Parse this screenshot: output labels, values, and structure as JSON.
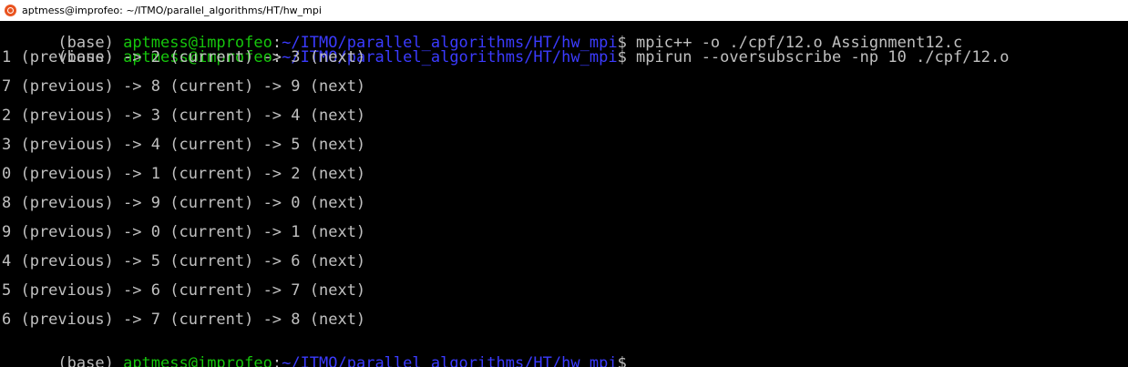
{
  "window": {
    "title": "aptmess@improfeo: ~/ITMO/parallel_algorithms/HT/hw_mpi",
    "icon": "ubuntu-icon"
  },
  "colors": {
    "user_host": "#16c60c",
    "path": "#3b3bff",
    "text": "#c0c0c0",
    "background": "#000000"
  },
  "prompt": {
    "env": "(base) ",
    "user_host": "aptmess@improfeo",
    "sep": ":",
    "path": "~/ITMO/parallel_algorithms/HT/hw_mpi",
    "symbol": "$ "
  },
  "commands": [
    "mpic++ -o ./cpf/12.o Assignment12.c",
    "mpirun --oversubscribe -np 10 ./cpf/12.o"
  ],
  "output": [
    "1 (previous) -> 2 (current) -> 3 (next)",
    "7 (previous) -> 8 (current) -> 9 (next)",
    "2 (previous) -> 3 (current) -> 4 (next)",
    "3 (previous) -> 4 (current) -> 5 (next)",
    "0 (previous) -> 1 (current) -> 2 (next)",
    "8 (previous) -> 9 (current) -> 0 (next)",
    "9 (previous) -> 0 (current) -> 1 (next)",
    "4 (previous) -> 5 (current) -> 6 (next)",
    "5 (previous) -> 6 (current) -> 7 (next)",
    "6 (previous) -> 7 (current) -> 8 (next)"
  ]
}
